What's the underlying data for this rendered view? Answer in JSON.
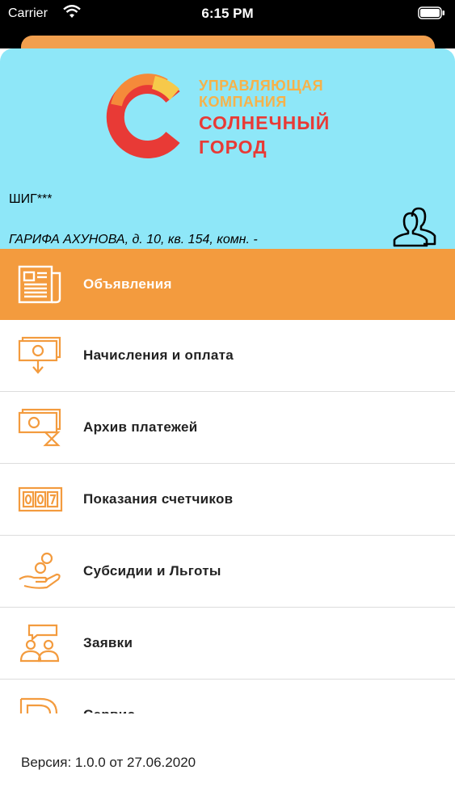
{
  "status_bar": {
    "carrier": "Carrier",
    "time": "6:15 PM"
  },
  "header": {
    "logo": {
      "line1": "УПРАВЛЯЮЩАЯ",
      "line2": "КОМПАНИЯ",
      "line3": "СОЛНЕЧНЫЙ",
      "line4": "ГОРОД"
    },
    "user_code": "ШИГ***",
    "address": "ГАРИФА АХУНОВА, д. 10, кв. 154, комн. -",
    "icon": "users-icon"
  },
  "menu": {
    "items": [
      {
        "label": "Объявления",
        "icon": "newspaper-icon",
        "active": true
      },
      {
        "label": "Начисления и оплата",
        "icon": "money-download-icon"
      },
      {
        "label": "Архив платежей",
        "icon": "money-hourglass-icon"
      },
      {
        "label": "Показания счетчиков",
        "icon": "meter-counter-icon"
      },
      {
        "label": "Субсидии и Льготы",
        "icon": "hand-coins-icon"
      },
      {
        "label": "Заявки",
        "icon": "people-chat-icon"
      },
      {
        "label": "Сервис",
        "icon": "service-icon"
      }
    ]
  },
  "footer": {
    "version": "Версия: 1.0.0 от 27.06.2020"
  },
  "colors": {
    "accent": "#f39b3e",
    "header_bg": "#8ee7f8",
    "logo_red": "#e83a36",
    "logo_yellow": "#f6b24a"
  }
}
